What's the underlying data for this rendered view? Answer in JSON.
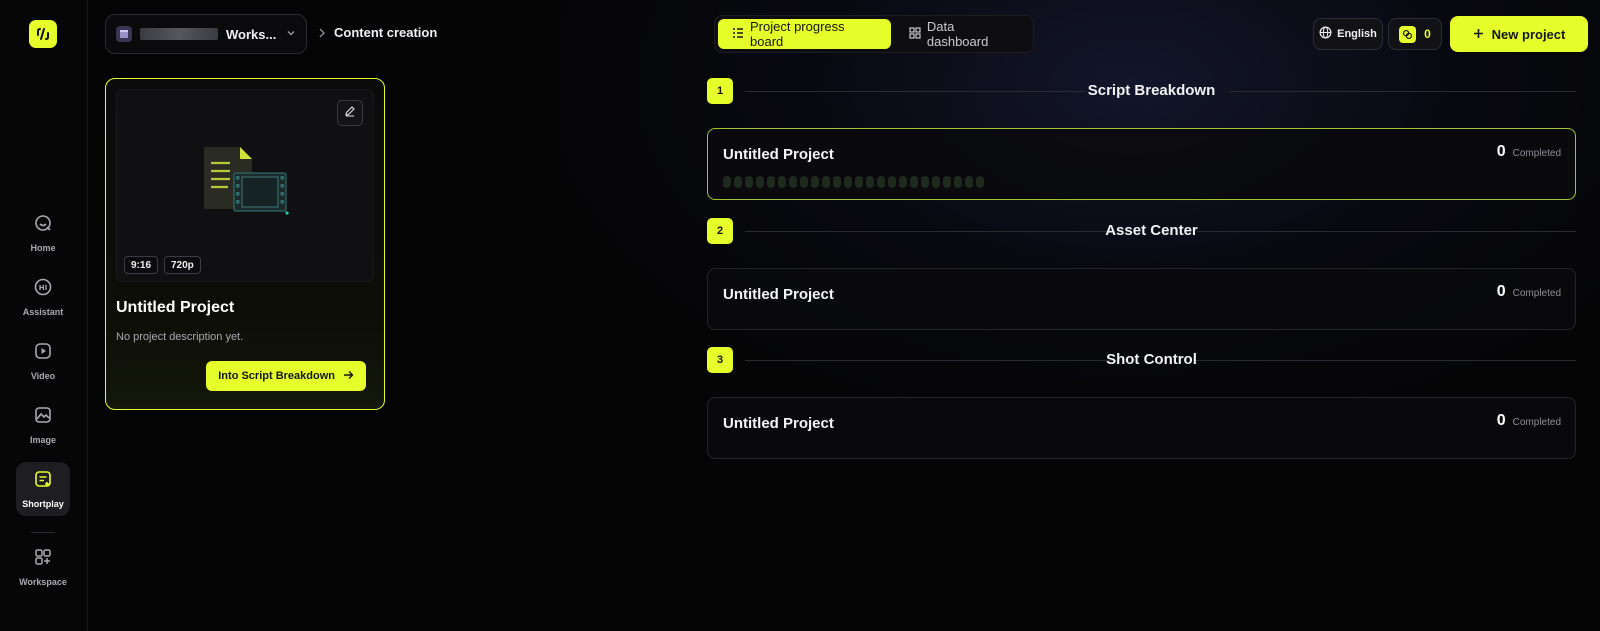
{
  "colors": {
    "accent": "#e6ff2a",
    "background": "#050506"
  },
  "sidebar": {
    "items": [
      {
        "label": "Home",
        "icon": "home-chat-icon"
      },
      {
        "label": "Assistant",
        "icon": "hi-bubble-icon"
      },
      {
        "label": "Video",
        "icon": "video-play-icon"
      },
      {
        "label": "Image",
        "icon": "image-icon"
      },
      {
        "label": "Shortplay",
        "icon": "shortplay-icon",
        "active": true
      },
      {
        "label": "Workspace",
        "icon": "grid-plus-icon"
      }
    ]
  },
  "header": {
    "workspace_name": "Works...",
    "breadcrumb": "Content creation",
    "tabs": [
      {
        "label": "Project progress board",
        "active": true
      },
      {
        "label": "Data dashboard",
        "active": false
      }
    ],
    "language": "English",
    "credits": "0",
    "new_project_label": "New project"
  },
  "project_card": {
    "title": "Untitled Project",
    "description": "No project description yet.",
    "aspect_chip": "9:16",
    "resolution_chip": "720p",
    "cta_label": "Into Script Breakdown"
  },
  "stages": [
    {
      "number": "1",
      "title": "Script Breakdown",
      "project_title": "Untitled Project",
      "count": "0",
      "count_label": "Completed"
    },
    {
      "number": "2",
      "title": "Asset Center",
      "project_title": "Untitled Project",
      "count": "0",
      "count_label": "Completed"
    },
    {
      "number": "3",
      "title": "Shot Control",
      "project_title": "Untitled Project",
      "count": "0",
      "count_label": "Completed"
    }
  ]
}
